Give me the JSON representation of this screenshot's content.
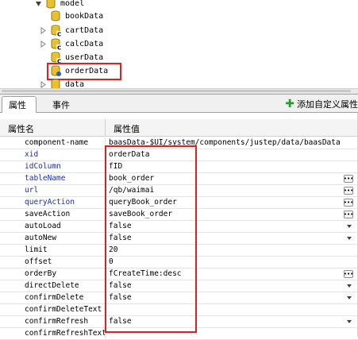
{
  "tree": {
    "root": "model",
    "items": [
      "bookData",
      "cartData",
      "calcData",
      "userData",
      "orderData",
      "data"
    ],
    "selected": "orderData"
  },
  "tabs": [
    "属性",
    "事件"
  ],
  "add_button": "添加自定义属性",
  "grid": {
    "header_name": "属性名",
    "header_value": "属性值",
    "rows": [
      {
        "name": "component-name",
        "value": "baasData-$UI/system/components/justep/data/baasData"
      },
      {
        "name": "xid",
        "value": "orderData"
      },
      {
        "name": "idColumn",
        "value": "fID"
      },
      {
        "name": "tableName",
        "value": "book_order"
      },
      {
        "name": "url",
        "value": "/qb/waimai"
      },
      {
        "name": "queryAction",
        "value": "queryBook_order"
      },
      {
        "name": "saveAction",
        "value": "saveBook_order"
      },
      {
        "name": "autoLoad",
        "value": "false"
      },
      {
        "name": "autoNew",
        "value": "false"
      },
      {
        "name": "limit",
        "value": "20"
      },
      {
        "name": "offset",
        "value": "0"
      },
      {
        "name": "orderBy",
        "value": "fCreateTime:desc"
      },
      {
        "name": "directDelete",
        "value": "false"
      },
      {
        "name": "confirmDelete",
        "value": "false"
      },
      {
        "name": "confirmDeleteText",
        "value": ""
      },
      {
        "name": "confirmRefresh",
        "value": "false"
      },
      {
        "name": "confirmRefreshText",
        "value": ""
      }
    ]
  },
  "colors": {
    "highlight": "#e02020",
    "blue_name": "#1a2eb8",
    "add_plus": "#2a9a2a"
  },
  "icons": {
    "db": "database-icon",
    "expand": "expand-arrow-icon",
    "collapse": "collapse-arrow-icon",
    "ellipsis": "ellipsis-button",
    "dropdown": "dropdown-arrow"
  }
}
